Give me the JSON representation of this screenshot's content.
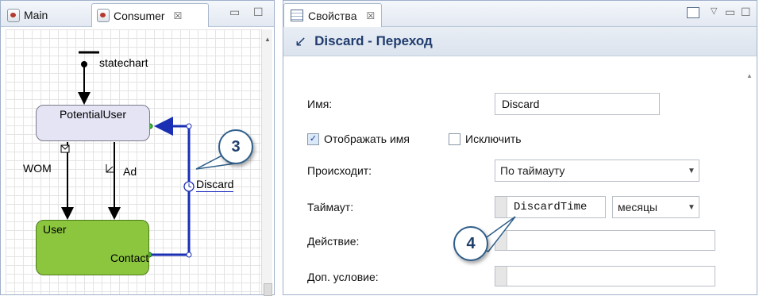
{
  "left_tabs": [
    {
      "label": "Main",
      "active": false
    },
    {
      "label": "Consumer",
      "active": true,
      "close": "☒"
    }
  ],
  "diagram": {
    "statechart_label": "statechart",
    "state_potential": "PotentialUser",
    "state_user": "User",
    "transition_wom": "WOM",
    "transition_ad": "Ad",
    "transition_discard": "Discard",
    "transition_contact": "Contact",
    "callout_3": "3"
  },
  "right_tab": {
    "label": "Свойства",
    "close": "☒"
  },
  "header": {
    "title": "Discard - Переход"
  },
  "form": {
    "name_label": "Имя:",
    "name_value": "Discard",
    "show_name_label": "Отображать имя",
    "show_name_checked": true,
    "exclude_label": "Исключить",
    "exclude_checked": false,
    "occurs_label": "Происходит:",
    "occurs_value": "По таймауту",
    "timeout_label": "Таймаут:",
    "timeout_value": "DiscardTime",
    "timeout_unit": "месяцы",
    "action_label": "Действие:",
    "action_value": "",
    "condition_label": "Доп. условие:",
    "condition_value": "",
    "callout_4": "4"
  },
  "colors": {
    "accent": "#203c6e",
    "user_state": "#8cc63f",
    "potential_state": "#e4e4f5",
    "transition": "#1a2fb4"
  }
}
